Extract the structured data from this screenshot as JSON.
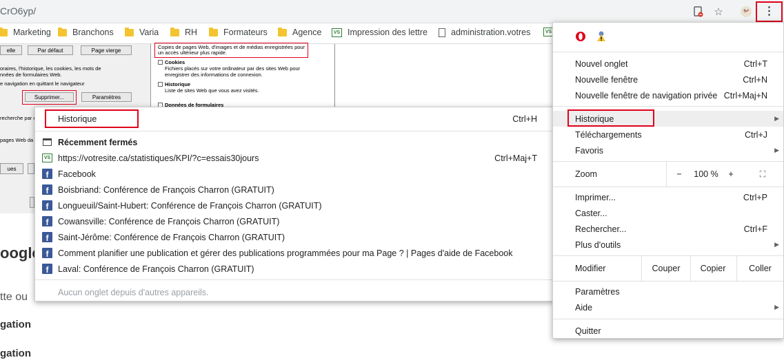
{
  "address_bar": {
    "url": "CrO6yp/"
  },
  "bookmarks": [
    {
      "label": "Marketing",
      "icon": "folder-icon"
    },
    {
      "label": "Branchons",
      "icon": "folder-icon"
    },
    {
      "label": "Varia",
      "icon": "folder-icon"
    },
    {
      "label": "RH",
      "icon": "folder-icon"
    },
    {
      "label": "Formateurs",
      "icon": "folder-icon"
    },
    {
      "label": "Agence",
      "icon": "folder-icon"
    },
    {
      "label": "Impression des lettre",
      "icon": "vs-icon"
    },
    {
      "label": "administration.votres",
      "icon": "page-icon"
    }
  ],
  "background_window": {
    "btn_1": "elle",
    "btn_2": "Par défaut",
    "btn_3": "Page vierge",
    "text_1": "oraires, l'historique, les cookies, les mots de",
    "text_2": "nnées de formulaires Web.",
    "text_3": "e navigation en quittant le navigateur",
    "delete_button": "Supprimer...",
    "params_button": "Paramètres",
    "text_4": "recherche par c",
    "text_5": "pages Web da",
    "btn_4": "ues",
    "pane_text_1": "Copies de pages Web, d'images et de médias enregistrées pour",
    "pane_text_2": "un accès ultérieur plus rapide.",
    "cookies_title": "Cookies",
    "cookies_text_1": "Fichiers placés sur votre ordinateur par des sites Web pour",
    "cookies_text_2": "enregistrer des informations de connexion.",
    "history_title": "Historique",
    "history_text": "Liste de sites Web que vous avez visités.",
    "forms_title": "Données de formulaires"
  },
  "page_text": {
    "heading": "oogle",
    "line_1": "tte ou",
    "line_2": "gation",
    "line_3": "gation"
  },
  "history_submenu": {
    "title": "Historique",
    "title_shortcut": "Ctrl+H",
    "recently_closed": "Récemment fermés",
    "items": [
      {
        "label": "https://votresite.ca/statistiques/KPI/?c=essais30jours",
        "shortcut": "Ctrl+Maj+T",
        "icon": "vs-icon"
      },
      {
        "label": "Facebook",
        "shortcut": "",
        "icon": "facebook-icon"
      },
      {
        "label": "Boisbriand: Conférence de François Charron (GRATUIT)",
        "shortcut": "",
        "icon": "facebook-icon"
      },
      {
        "label": "Longueuil/Saint-Hubert: Conférence de François Charron (GRATUIT)",
        "shortcut": "",
        "icon": "facebook-icon"
      },
      {
        "label": "Cowansville: Conférence de François Charron (GRATUIT)",
        "shortcut": "",
        "icon": "facebook-icon"
      },
      {
        "label": "Saint-Jérôme: Conférence de François Charron (GRATUIT)",
        "shortcut": "",
        "icon": "facebook-icon"
      },
      {
        "label": "Comment planifier une publication et gérer des publications programmées pour ma Page ? | Pages d'aide de Facebook",
        "shortcut": "",
        "icon": "facebook-icon"
      },
      {
        "label": "Laval: Conférence de François Charron (GRATUIT)",
        "shortcut": "",
        "icon": "facebook-icon"
      }
    ],
    "no_tabs": "Aucun onglet depuis d'autres appareils."
  },
  "chrome_menu": {
    "new_tab": "Nouvel onglet",
    "new_tab_sc": "Ctrl+T",
    "new_window": "Nouvelle fenêtre",
    "new_window_sc": "Ctrl+N",
    "incognito": "Nouvelle fenêtre de navigation privée",
    "incognito_sc": "Ctrl+Maj+N",
    "history": "Historique",
    "downloads": "Téléchargements",
    "downloads_sc": "Ctrl+J",
    "bookmarks": "Favoris",
    "zoom": "Zoom",
    "zoom_minus": "−",
    "zoom_value": "100 %",
    "zoom_plus": "+",
    "fullscreen": "⛶",
    "print": "Imprimer...",
    "print_sc": "Ctrl+P",
    "cast": "Caster...",
    "find": "Rechercher...",
    "find_sc": "Ctrl+F",
    "more_tools": "Plus d'outils",
    "edit": "Modifier",
    "cut": "Couper",
    "copy": "Copier",
    "paste": "Coller",
    "settings": "Paramètres",
    "help": "Aide",
    "quit": "Quitter"
  },
  "colors": {
    "highlight_red": "#e0001a",
    "facebook_blue": "#3b5998",
    "hover_grey": "#eeeeee"
  }
}
